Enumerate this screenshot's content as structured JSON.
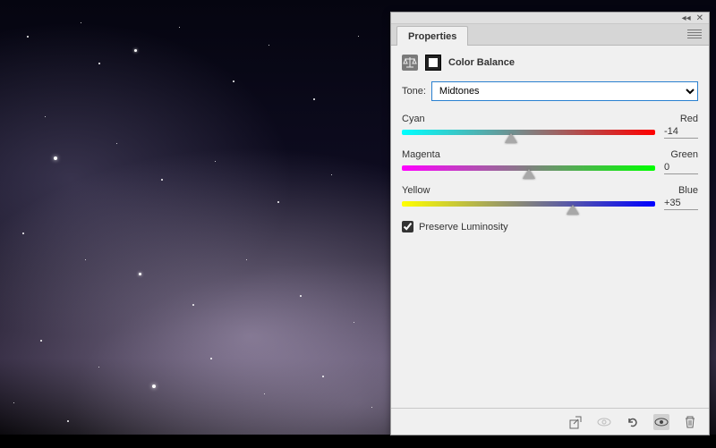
{
  "panel": {
    "tab_label": "Properties",
    "adjustment_title": "Color Balance",
    "tone_label": "Tone:",
    "tone_value": "Midtones",
    "sliders": [
      {
        "left": "Cyan",
        "right": "Red",
        "value": "-14",
        "pos_pct": 43
      },
      {
        "left": "Magenta",
        "right": "Green",
        "value": "0",
        "pos_pct": 50
      },
      {
        "left": "Yellow",
        "right": "Blue",
        "value": "+35",
        "pos_pct": 67.5
      }
    ],
    "preserve_label": "Preserve Luminosity",
    "preserve_checked": true
  }
}
